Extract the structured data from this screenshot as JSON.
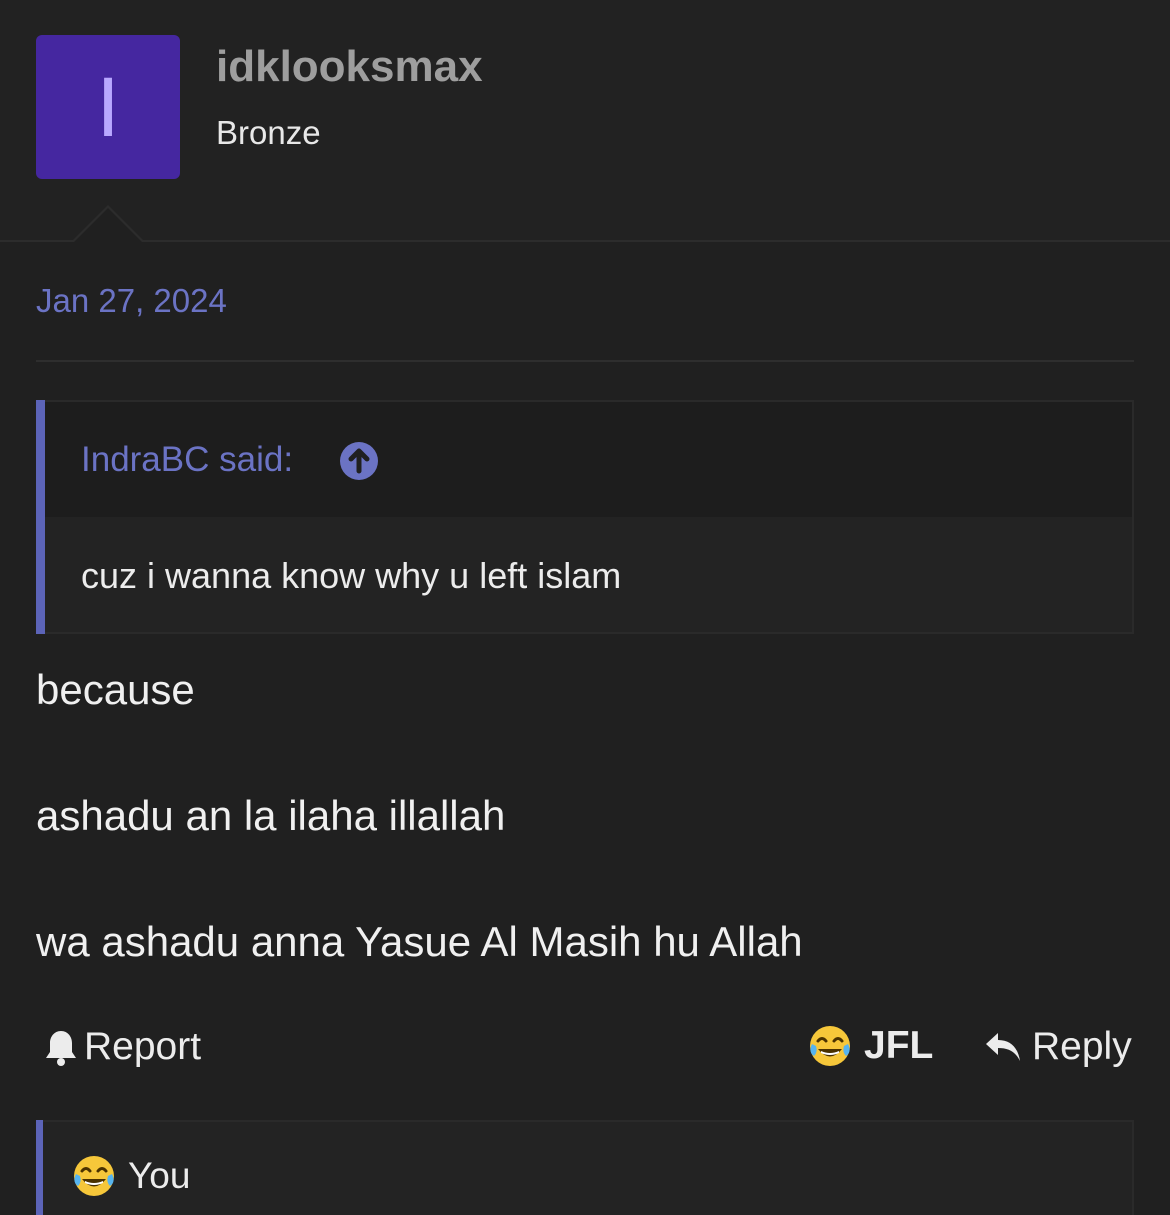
{
  "user": {
    "avatar_letter": "I",
    "avatar_color": "#4527a0",
    "username": "idklooksmax",
    "title": "Bronze"
  },
  "post": {
    "date": "Jan 27, 2024",
    "quote": {
      "author_label": "IndraBC said:",
      "jump_icon": "arrow-up-circle-icon",
      "text": "cuz i wanna know why u left islam"
    },
    "body": [
      "because",
      "ashadu an la ilaha illallah",
      "wa ashadu anna Yasue Al Masih hu Allah"
    ]
  },
  "actions": {
    "report_label": "Report",
    "report_icon": "bell-icon",
    "reaction_label": "JFL",
    "reaction_icon": "face-with-tears-of-joy-icon",
    "reply_label": "Reply",
    "reply_icon": "reply-arrow-icon"
  },
  "reactions": {
    "icon": "face-with-tears-of-joy-icon",
    "text": "You"
  },
  "colors": {
    "accent": "#6b73c4",
    "background": "#202020"
  }
}
